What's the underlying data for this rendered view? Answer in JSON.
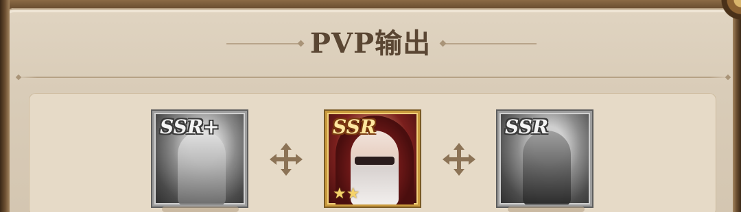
{
  "title": "PVP输出",
  "heroes": [
    {
      "rarity": "SSR+",
      "stars": "",
      "style": "grayscale"
    },
    {
      "rarity": "SSR",
      "stars": "★★",
      "style": "color"
    },
    {
      "rarity": "SSR",
      "stars": "",
      "style": "grayscale"
    }
  ],
  "separator_icon": "move-cross-icon",
  "colors": {
    "parchment": "#d9ccb8",
    "title_text": "#5a4633",
    "card_border": "#c99a3e",
    "frame": "#6b4f31"
  }
}
